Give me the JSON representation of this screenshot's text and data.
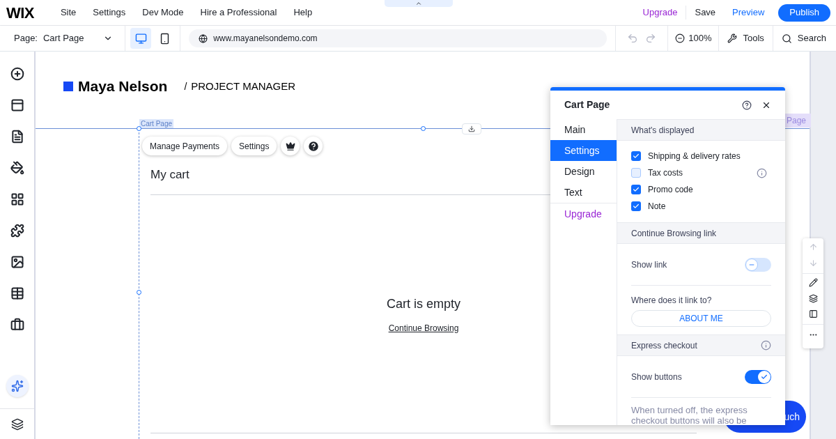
{
  "top_menu": {
    "logo": "WIX",
    "items": [
      "Site",
      "Settings",
      "Dev Mode",
      "Hire a Professional",
      "Help"
    ],
    "upgrade": "Upgrade",
    "save": "Save",
    "preview": "Preview",
    "publish": "Publish"
  },
  "toolbar": {
    "page_label": "Page:",
    "page_value": "Cart Page",
    "devices": [
      {
        "kind": "desktop",
        "selected": true
      },
      {
        "kind": "mobile",
        "selected": false
      }
    ],
    "url": "www.mayanelsondemo.com",
    "zoom": "100%",
    "tools": "Tools",
    "search": "Search"
  },
  "site": {
    "name": "Maya Nelson",
    "separator": "/",
    "role": "PROJECT MANAGER",
    "selection_label": "Cart Page",
    "side_tag": "Page",
    "actions": [
      "Manage Payments",
      "Settings"
    ],
    "cart_title": "My cart",
    "empty_title": "Cart is empty",
    "continue_link": "Continue Browsing",
    "cta_fragment": "uch"
  },
  "panel": {
    "title": "Cart Page",
    "tabs": [
      {
        "label": "Main",
        "kind": "tab",
        "selected": false
      },
      {
        "label": "Settings",
        "kind": "tab",
        "selected": true
      },
      {
        "label": "Design",
        "kind": "tab",
        "selected": false
      },
      {
        "label": "Text",
        "kind": "tab",
        "selected": false
      },
      {
        "label": "Upgrade",
        "kind": "upgrade",
        "selected": false
      }
    ],
    "rows": [
      {
        "kind": "header",
        "label": "What's displayed",
        "info": false
      },
      {
        "kind": "checkbox",
        "label": "Shipping & delivery rates",
        "checked": true,
        "info": false
      },
      {
        "kind": "checkbox",
        "label": "Tax costs",
        "checked": false,
        "info": true
      },
      {
        "kind": "checkbox",
        "label": "Promo code",
        "checked": true,
        "info": false
      },
      {
        "kind": "checkbox",
        "label": "Note",
        "checked": true,
        "info": false
      },
      {
        "kind": "header",
        "label": "Continue Browsing link",
        "info": false
      },
      {
        "kind": "toggle",
        "label": "Show link",
        "on": false
      },
      {
        "kind": "link",
        "label": "Where does it link to?",
        "value": "ABOUT ME"
      },
      {
        "kind": "header",
        "label": "Express checkout",
        "info": true
      },
      {
        "kind": "toggle",
        "label": "Show buttons",
        "on": true
      },
      {
        "kind": "note",
        "label": "When turned off, the express checkout buttons will also be"
      }
    ]
  }
}
